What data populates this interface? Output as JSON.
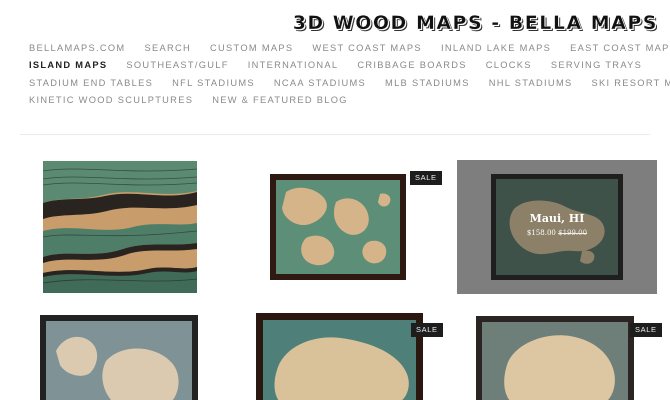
{
  "brand": {
    "title": "3D WOOD MAPS - BELLA MAPS"
  },
  "nav": {
    "rows": [
      [
        "BELLAMAPS.COM",
        "SEARCH",
        "CUSTOM MAPS",
        "WEST COAST MAPS",
        "INLAND LAKE MAPS",
        "EAST COAST MAPS"
      ],
      [
        "ISLAND MAPS",
        "SOUTHEAST/GULF",
        "INTERNATIONAL",
        "CRIBBAGE BOARDS",
        "CLOCKS",
        "SERVING TRAYS"
      ],
      [
        "STADIUM END TABLES",
        "NFL STADIUMS",
        "NCAA STADIUMS",
        "MLB STADIUMS",
        "NHL STADIUMS",
        "SKI RESORT MAPS"
      ],
      [
        "KINETIC WOOD SCULPTURES",
        "NEW & FEATURED BLOG"
      ]
    ],
    "active": "ISLAND MAPS"
  },
  "products": {
    "sale_badge": "SALE",
    "hovered": {
      "title": "Maui, HI",
      "price": "$158.00",
      "old_price": "$199.00"
    }
  }
}
